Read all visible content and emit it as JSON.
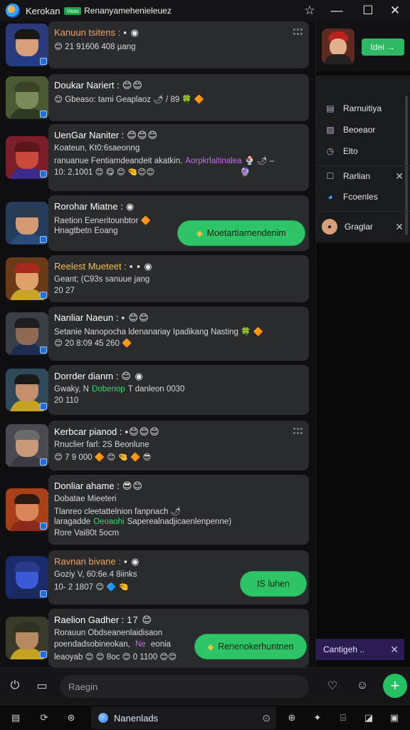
{
  "titlebar": {
    "app_name": "Kerokan",
    "badge": "Vaas",
    "subtitle": "Renanyamehenieleuez",
    "icons": [
      "app-logo-icon",
      "star-icon",
      "minimize-icon",
      "maximize-icon",
      "close-icon"
    ]
  },
  "chats": [
    {
      "name": "Kanuun tsitens :",
      "name_color": "#f2a35a",
      "tags": "▪ ◉",
      "lines": [
        {
          "text": "😊 21 91606 408 µang"
        }
      ],
      "has_menu": true,
      "avatar": {
        "bg": "#2b3a7a",
        "skin": "#d8a07a",
        "hair": "#1b1714",
        "body": "#213c82"
      }
    },
    {
      "name": "Doukar Nariert :",
      "name_color": "#ffffff",
      "tags": "😊😊",
      "lines": [
        {
          "text": "😊 Gbeaso: tami Geaplaoz 🌶 / 89 🍀 🔶"
        }
      ],
      "avatar": {
        "bg": "#4c5a33",
        "skin": "#7c8b5a",
        "hair": "#3a4226",
        "body": "#2e3a24"
      }
    },
    {
      "name": "UenGar Naniter :",
      "name_color": "#ffffff",
      "tags": "😊😊😊",
      "lines": [
        {
          "text": "Koateun, Kt0:6saeonng"
        },
        {
          "text": "ranuanue  Fentiamdeandeit akatkin.",
          "extra": "Aorpkrlaitinalea",
          "extra2": "🍨 🌶 –"
        },
        {
          "text": "10: 2,1001  😊 😋 😊 🤏😊😊",
          "extra3": "🔮"
        }
      ],
      "avatar": {
        "bg": "#7a1f2a",
        "skin": "#c94a3a",
        "hair": "#5a1618",
        "body": "#3a2b8a"
      }
    },
    {
      "name": "Rorohar Miatne :",
      "name_color": "#ffffff",
      "tags": "◉",
      "lines": [
        {
          "text": "Raetion Eeneritounbtor 🔶"
        },
        {
          "text": "Hnagtbetn Eoang"
        }
      ],
      "pill": "Moetartiarnendenim",
      "avatar": {
        "bg": "#243c5a",
        "skin": "#d49a74",
        "hair": "#2c3b4f",
        "body": "#2a4a7a"
      }
    },
    {
      "name": "Reelest Mueteet :",
      "name_color": "#f2c14e",
      "tags": "▪ ▪ ◉",
      "lines": [
        {
          "text": "Geant; (C93s sanuue jang"
        },
        {
          "text": "20 27"
        }
      ],
      "avatar": {
        "bg": "#6a3a16",
        "skin": "#e0a06a",
        "hair": "#a82a1f",
        "body": "#c9a323"
      }
    },
    {
      "name": "Nanliar Naeun :",
      "name_color": "#ffffff",
      "tags": "▪ 😊😊",
      "lines": [
        {
          "text": "Setanie Nanopocha ldenanariay Ipadikang Nasting 🍀 🔶"
        },
        {
          "text": "😊 20 8:09 45 260 🔶"
        }
      ],
      "avatar": {
        "bg": "#3a3f46",
        "skin": "#8f6a52",
        "hair": "#1c1e22",
        "body": "#1d2d52"
      }
    },
    {
      "name": "Dorrder dianm :",
      "name_color": "#ffffff",
      "tags": "😊 ◉",
      "lines": [
        {
          "text": "Gwaky, N",
          "extra": "Dobenop",
          "extra_post": "T danleon 0030"
        },
        {
          "text": "20       110"
        }
      ],
      "avatar": {
        "bg": "#2e4a5a",
        "skin": "#c48f6c",
        "hair": "#1a1a1a",
        "body": "#c5a21f"
      }
    },
    {
      "name": "Kerbcar pianod :",
      "name_color": "#ffffff",
      "tags": "▪😊😊😊",
      "lines": [
        {
          "text": "Rnuclier farl: 2S Beonlune"
        },
        {
          "text": "😊 7 9 000  🔶 😊 🤏 🔶 😎"
        }
      ],
      "has_menu": true,
      "avatar": {
        "bg": "#4a4a52",
        "skin": "#c89a7a",
        "hair": "#6a6a6a",
        "body": "#3a3a44"
      }
    },
    {
      "name": "Donliar ahame :",
      "name_color": "#ffffff",
      "tags": "😎😊",
      "lines": [
        {
          "text": "Dobatae Mieeteri"
        },
        {
          "text": "Tlanreo cleetattelnion fanpnach 🌶"
        },
        {
          "text": "laragadde",
          "extra": "Oeoaohi",
          "extra_post": "Saperealnadjicaenlenpenne)"
        },
        {
          "text": "Rore Vai80t 5ocm"
        }
      ],
      "avatar": {
        "bg": "#a8401a",
        "skin": "#d8865a",
        "hair": "#2a1a12",
        "body": "#8a2a1a"
      }
    },
    {
      "name": "Ravnan bivane :",
      "name_color": "#f2a35a",
      "tags": "▪ ◉",
      "lines": [
        {
          "text": "Goziy V, 60:6e.4 8iinks"
        },
        {
          "text": "10- 2 1807  😊 🔷 🤏"
        }
      ],
      "pill": "IS luhen",
      "avatar": {
        "bg": "#1a2a6a",
        "skin": "#3a5ad8",
        "hair": "#2a3a8a",
        "body": "#1a2a5a"
      }
    },
    {
      "name": "Raelion Gadher :",
      "name_color": "#ffffff",
      "tags": "17 😊",
      "lines": [
        {
          "text": "Rorauun Obdseanenlaidisaon"
        },
        {
          "text": "poendadsobineokan, ",
          "extra": "Ne",
          "extra_post": " eonia"
        },
        {
          "text": "leaoyab 😊 😊 8oc 😊 0 1100 😊😊"
        }
      ],
      "pill": "Renenokerhuntnen",
      "avatar": {
        "bg": "#3a3a2a",
        "skin": "#b88a62",
        "hair": "#2e3222",
        "body": "#c5a21f"
      }
    }
  ],
  "right_panel": {
    "add_button": "Idei →",
    "items": [
      {
        "icon": "list-icon",
        "label": "Rarnuitiya"
      },
      {
        "icon": "image-icon",
        "label": "Beoeaor"
      },
      {
        "icon": "clock-icon",
        "label": "Elto"
      },
      {
        "icon": "checkbox-icon",
        "label": "Rarlian",
        "closable": true
      },
      {
        "icon": "globe-icon",
        "label": "Fcoenles"
      },
      {
        "icon": "user-icon",
        "label": "Graglar",
        "closable": true
      }
    ],
    "bottom_item": "Cantigeh .."
  },
  "composer": {
    "placeholder": "Raegin",
    "icons": [
      "power-icon",
      "book-icon",
      "heart-icon",
      "sticker-icon",
      "plus-icon"
    ]
  },
  "taskbar": {
    "active_label": "Nanenlads",
    "icons": [
      "calendar-icon",
      "refresh-icon",
      "gamepad-icon",
      "settings-icon",
      "compass-icon",
      "puzzle-icon",
      "binary-icon",
      "image-edit-icon",
      "chat-icon"
    ]
  },
  "colors": {
    "accent_green": "#2fc467",
    "bubble_bg": "#2a2b2e",
    "background": "#0f0f11",
    "purple_item": "#2b1d54"
  }
}
